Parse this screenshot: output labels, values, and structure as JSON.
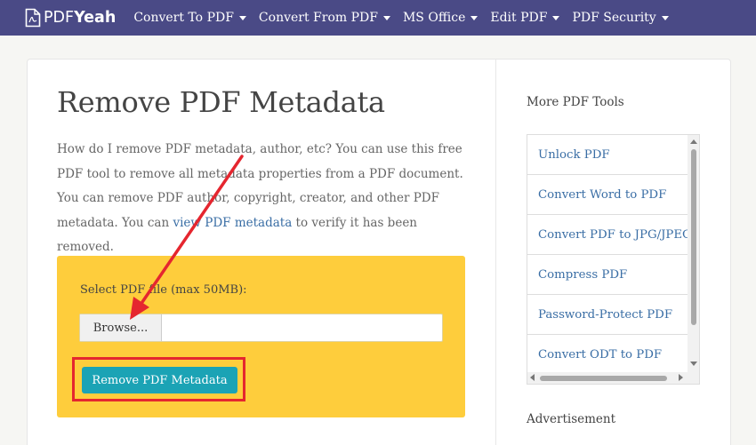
{
  "nav": {
    "logo_prefix": "PDF",
    "logo_suffix": "Yeah",
    "menu": [
      {
        "label": "Convert To PDF"
      },
      {
        "label": "Convert From PDF"
      },
      {
        "label": "MS Office"
      },
      {
        "label": "Edit PDF"
      },
      {
        "label": "PDF Security"
      }
    ]
  },
  "main": {
    "title": "Remove PDF Metadata",
    "description_before": "How do I remove PDF metadata, author, etc? You can use this free PDF tool to remove all metadata properties from a PDF document. You can remove PDF author, copyright, creator, and other PDF metadata. You can ",
    "description_link": "view PDF metadata",
    "description_after": " to verify it has been removed.",
    "upload": {
      "label": "Select PDF file (max 50MB):",
      "browse_label": "Browse...",
      "file_value": "",
      "submit_label": "Remove PDF Metadata"
    }
  },
  "sidebar": {
    "title": "More PDF Tools",
    "tools": [
      {
        "label": "Unlock PDF"
      },
      {
        "label": "Convert Word to PDF"
      },
      {
        "label": "Convert PDF to JPG/JPEG"
      },
      {
        "label": "Compress PDF"
      },
      {
        "label": "Password-Protect PDF"
      },
      {
        "label": "Convert ODT to PDF"
      }
    ],
    "ad_label": "Advertisement"
  },
  "colors": {
    "nav_bg": "#4a4a86",
    "upload_bg": "#fecd3c",
    "submit_bg": "#1ba3b5",
    "highlight": "#e5262f",
    "link": "#3a6ea5"
  }
}
